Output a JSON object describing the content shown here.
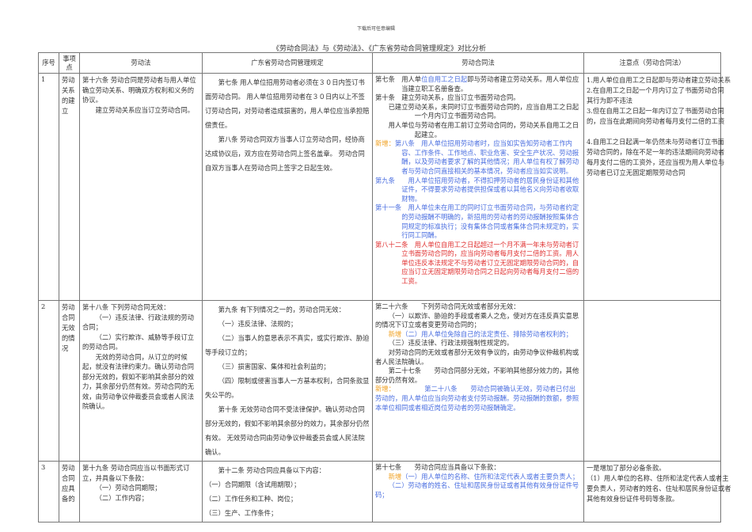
{
  "page_note": "下载后可任意编辑",
  "title": "《劳动合同法》与《劳动法》、《广东省劳动合同管理规定》对比分析",
  "headers": [
    "序号",
    "事项点",
    "劳动法",
    "广东省劳动合同管理规定",
    "劳动合同法",
    "注意点（劳动合同法）"
  ],
  "colors": {
    "black": "#333333",
    "blue": "#4a6ee0",
    "orange": "#f0a020",
    "red": "#e03030"
  },
  "rows": [
    {
      "seq": "1",
      "topic": "劳动关系的建立",
      "labor_law": [
        {
          "t": "第十六条 劳动合同是劳动者与用人单位确立劳动关系、明确双方权利和义务的协议。",
          "s": ""
        },
        {
          "t": "建立劳动关系应当订立劳动合同。",
          "s": "ind"
        }
      ],
      "guangdong": [
        {
          "t": "第七条 用人单位招用劳动者必须在３０日内签订书面劳动合同。 用人单位招用劳动者在３０日内以上不签订劳动合同，对劳动者造成损害的，用人单位应当承担赔偿责任。",
          "s": "ind"
        },
        {
          "t": "第八条 劳动合同双方当事人订立劳动合同，经协商达成协议后，双方应在劳动合同上签名盖章。 劳动合同自双方当事人在劳动合同上签字之日起生效。",
          "s": "ind"
        }
      ],
      "contract_law": [
        {
          "s": "hang",
          "segs": [
            {
              "t": "第七条　用人单",
              "c": "k"
            },
            {
              "t": "位自用工之日起",
              "c": "b"
            },
            {
              "t": "即与劳动者建立劳动关系。用人单位应当建立职工名册备查。",
              "c": "k"
            }
          ]
        },
        {
          "s": "",
          "segs": [
            {
              "t": "第十条　建立劳动关系，应当订立书面劳动合同。",
              "c": "k"
            }
          ]
        },
        {
          "s": "hang ind2",
          "segs": [
            {
              "t": "已建立劳动关系，未同时订立书面劳动合同的，应当自用工之日起一个月内订立书面劳动合同。",
              "c": "k"
            }
          ]
        },
        {
          "s": "hang ind2",
          "segs": [
            {
              "t": "用人单位与劳动者在用工前订立劳动合同的，劳动关系自用工之日起建立。",
              "c": "k"
            }
          ]
        },
        {
          "s": "hang",
          "segs": [
            {
              "t": "新增：",
              "c": "o"
            },
            {
              "t": "第八条　用人单位招用劳动者时，应当如实告知劳动者工作内容、工作条件、工作地点、职业危害、安全生产状况、劳动报酬，以及劳动者要求了解的其他情况；用人单位有权了解劳动者与劳动合同直接相关的基本情况，劳动者应当如实说明。",
              "c": "b"
            }
          ]
        },
        {
          "s": "hang",
          "segs": [
            {
              "t": "第九条　　用人单位招用劳动者，不得扣押劳动者的居民身份证和其他证件，不得要求劳动者提供担保或者以其他名义向劳动者收取财物。",
              "c": "b"
            }
          ]
        },
        {
          "s": "hang",
          "segs": [
            {
              "t": "第十一条　用人单位未在用工的同时订立书面劳动合同，与劳动者约定的劳动报酬不明确的，新招用的劳动者的劳动报酬按照集体合同规定的标准执行；没有集体合同或者集体合同未规定的，实行同工同酬。",
              "c": "b"
            }
          ]
        },
        {
          "s": "hang",
          "segs": [
            {
              "t": "第八十二条　用人单位自用工之日起超过一个月不满一年未与劳动者订立书面劳动合同的，应当向劳动者每月支付二倍的工资。用人单位违反本法规定不与劳动者订立无固定期限劳动合同的，自应当订立无固定期限劳动合同之日起向劳动者每月支付二倍的工资。",
              "c": "r"
            }
          ]
        }
      ],
      "notes": [
        "1.用人单位自用工之日起即与劳动者建立劳动关系",
        "2.在自用工之日起一个月内订立了书面劳动合同",
        "其行为即不违法",
        "3.但在自用工之日起一年内订立了书面劳动合同",
        "的，应当在此期间向劳动者每月支付二倍的工资",
        "",
        " 4.自用工之日起满一年仍然未与劳动者订立书面",
        " 劳动合同的，除在不足一年的违法期间向劳动者",
        " 每月支付二倍的工资外，还应当视为用人单位与",
        " 劳动者已订立无固定期限劳动合同"
      ]
    },
    {
      "seq": "2",
      "topic": "劳动合同无效的情况",
      "labor_law": [
        {
          "t": "第十八条 下列劳动合同无效：",
          "s": ""
        },
        {
          "t": "（一）违反法律、行政法规的劳动合同；",
          "s": "ind"
        },
        {
          "t": "（二）实行欺诈、威胁等手段订立的劳动合同。",
          "s": "ind"
        },
        {
          "t": "无效的劳动合同，从订立的时候起，就没有法律约束力。确认劳动合同部分无效的，假如不影响其余部分的效力，其余部分仍然有效。劳动合同的无效，由劳动争议仲裁委员会或者人民法院确认。",
          "s": "ind"
        }
      ],
      "guangdong": [
        {
          "t": "第九条 有下列情况之一的，劳动合同无效：",
          "s": "ind"
        },
        {
          "t": "（一）违反法律、法规的；",
          "s": "ind"
        },
        {
          "t": "（二）当事人的意思表示不真实，或实行欺诈、胁迫等手段订立的；",
          "s": "ind"
        },
        {
          "t": "（三）损害国家、集体和社会利益的；",
          "s": "ind"
        },
        {
          "t": "（四）限制或侵害当事人一方基本权利，合同条款显失公平的。",
          "s": "ind"
        },
        {
          "t": "第十条 无效劳动合同不受法律保护。确认劳动合同部分无效的，假如不影响其余部分的效力，其余部分仍然有效。 无效劳动合同由劳动争议仲裁委员会或人民法院确认。",
          "s": "ind"
        }
      ],
      "contract_law": [
        {
          "s": "",
          "segs": [
            {
              "t": " 第二十六条　　下列劳动合同无效或者部分无效：",
              "c": "k"
            }
          ]
        },
        {
          "s": "ind",
          "segs": [
            {
              "t": "（一）以欺诈、胁迫的手段或者乘人之危，使对方在违反真实意思的情况下订立或者变更劳动合同的；",
              "c": "k"
            }
          ]
        },
        {
          "s": "ind",
          "segs": [
            {
              "t": "新增",
              "c": "o"
            },
            {
              "t": "（二）用人单位免除自己的法定责任、排除劳动者权利的；",
              "c": "b"
            }
          ]
        },
        {
          "s": "ind",
          "segs": [
            {
              "t": "（三）违反法律、行政法规强制性规定的。",
              "c": "k"
            }
          ]
        },
        {
          "s": "ind",
          "segs": [
            {
              "t": "对劳动合同的无效或者部分无效有争议的，由劳动争议仲裁机构或者人民法院确认。",
              "c": "k"
            }
          ]
        },
        {
          "s": "ind",
          "segs": [
            {
              "t": "第二十七条　　劳动合同部分无效，不影响其他部分效力的，其他部分仍然有效。",
              "c": "k"
            }
          ]
        },
        {
          "s": "",
          "segs": [
            {
              "t": "新增：",
              "c": "o"
            },
            {
              "t": "　　　　　第二十八条　　劳动合同被确认无效，劳动者已付出劳动的，用人单位应当向劳动者支付劳动报酬。劳动报酬的数额，参照本单位相同或者相近岗位劳动者的劳动报酬确定。",
              "c": "b"
            }
          ]
        }
      ],
      "notes": []
    },
    {
      "seq": "3",
      "topic": "劳动合同应具备的",
      "labor_law": [
        {
          "t": "第十九条 劳动合同应当以书面形式订立，并具备以下条款：",
          "s": ""
        },
        {
          "t": "（一）劳动合同期限；",
          "s": "ind"
        },
        {
          "t": "（二）工作内容；",
          "s": "ind"
        }
      ],
      "guangdong": [
        {
          "t": "第十二条 劳动合同应具备以下内容：",
          "s": "ind"
        },
        {
          "t": "（一）合同期限（含试用期限）；",
          "s": ""
        },
        {
          "t": "（二）工作任务和工种、岗位；",
          "s": ""
        },
        {
          "t": "（三）生产、工作条件；",
          "s": ""
        }
      ],
      "contract_law": [
        {
          "s": "",
          "segs": [
            {
              "t": " 第十七条　　劳动合同应当具备以下条款：",
              "c": "k"
            }
          ]
        },
        {
          "s": "ind",
          "segs": [
            {
              "t": "新增",
              "c": "o"
            },
            {
              "t": "（一）用人单位的名称、住所和法定代表人或者主要负责人；",
              "c": "b"
            }
          ]
        },
        {
          "s": "ind",
          "segs": [
            {
              "t": "（二）劳动者的姓名、住址和居民身份证或者其他有效身份证件号码；",
              "c": "b"
            }
          ]
        }
      ],
      "notes": [
        "一是增加了部分必备条款。",
        "（1）用人单位的名称、住所和法定代表人或者主",
        "要负责人，劳动者的姓名、住址和居民身份证或者",
        "其他有效身份证件号码等条款。"
      ]
    }
  ]
}
